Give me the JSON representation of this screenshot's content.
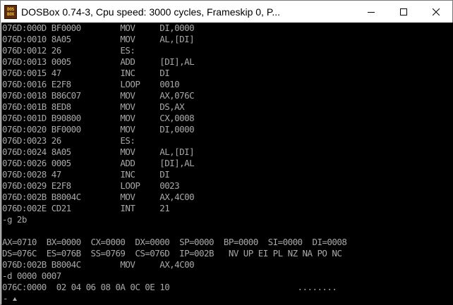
{
  "window": {
    "title": "DOSBox 0.74-3, Cpu speed:      3000 cycles, Frameskip  0, P...",
    "icon_text_top": "DOS",
    "icon_text_bottom": "BOX",
    "icons": {
      "app": "dosbox-icon",
      "minimize": "minimize-icon",
      "maximize": "maximize-icon",
      "close": "close-icon"
    }
  },
  "terminal": {
    "lines": [
      "076D:000D BF0000        MOV     DI,0000",
      "076D:0010 8A05          MOV     AL,[DI]",
      "076D:0012 26            ES:",
      "076D:0013 0005          ADD     [DI],AL",
      "076D:0015 47            INC     DI",
      "076D:0016 E2F8          LOOP    0010",
      "076D:0018 B86C07        MOV     AX,076C",
      "076D:001B 8ED8          MOV     DS,AX",
      "076D:001D B90800        MOV     CX,0008",
      "076D:0020 BF0000        MOV     DI,0000",
      "076D:0023 26            ES:",
      "076D:0024 8A05          MOV     AL,[DI]",
      "076D:0026 0005          ADD     [DI],AL",
      "076D:0028 47            INC     DI",
      "076D:0029 E2F8          LOOP    0023",
      "076D:002B B8004C        MOV     AX,4C00",
      "076D:002E CD21          INT     21",
      "-g 2b",
      "",
      "AX=0710  BX=0000  CX=0000  DX=0000  SP=0000  BP=0000  SI=0000  DI=0008",
      "DS=076C  ES=076B  SS=0769  CS=076D  IP=002B   NV UP EI PL NZ NA PO NC",
      "076D:002B B8004C        MOV     AX,4C00",
      "-d 0000 0007",
      "076C:0000  02 04 06 08 0A 0C 0E 10                          ........"
    ],
    "prompt": "-",
    "colors": {
      "background": "#000000",
      "foreground": "#a8a8a8"
    }
  }
}
